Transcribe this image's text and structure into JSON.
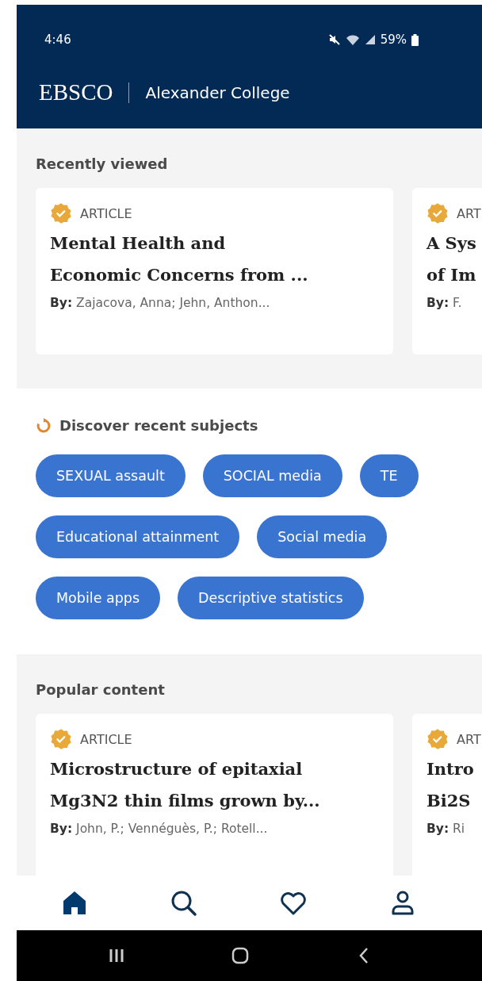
{
  "status_bar": {
    "time": "4:46",
    "battery": "59%"
  },
  "header": {
    "brand": "EBSCO",
    "institution": "Alexander College"
  },
  "recently_viewed": {
    "title": "Recently viewed",
    "cards": [
      {
        "type": "ARTICLE",
        "title_lines": [
          "Mental Health and",
          "Economic Concerns from ..."
        ],
        "by_label": "By:",
        "authors": "Zajacova, Anna; Jehn, Anthon..."
      },
      {
        "type": "ART",
        "title_lines": [
          "A Sys",
          "of Im"
        ],
        "by_label": "By:",
        "authors": "F."
      }
    ]
  },
  "discover": {
    "title": "Discover recent subjects",
    "chip_rows": [
      [
        "SEXUAL assault",
        "SOCIAL media",
        "TE"
      ],
      [
        "Educational attainment",
        "Social media"
      ],
      [
        "Mobile apps",
        "Descriptive statistics"
      ]
    ]
  },
  "popular": {
    "title": "Popular content",
    "cards": [
      {
        "type": "ARTICLE",
        "title_lines": [
          "Microstructure of epitaxial",
          "Mg3N2 thin films grown by..."
        ],
        "by_label": "By:",
        "authors": "John, P.; Vennéguès, P.; Rotell..."
      },
      {
        "type": "ART",
        "title_lines": [
          "Intro",
          "Bi2S"
        ],
        "by_label": "By:",
        "authors": "Ri"
      }
    ]
  },
  "bottom_nav": [
    {
      "kind": "home",
      "selected": true
    },
    {
      "kind": "search",
      "selected": false
    },
    {
      "kind": "favorites",
      "selected": false
    },
    {
      "kind": "profile",
      "selected": false
    }
  ]
}
